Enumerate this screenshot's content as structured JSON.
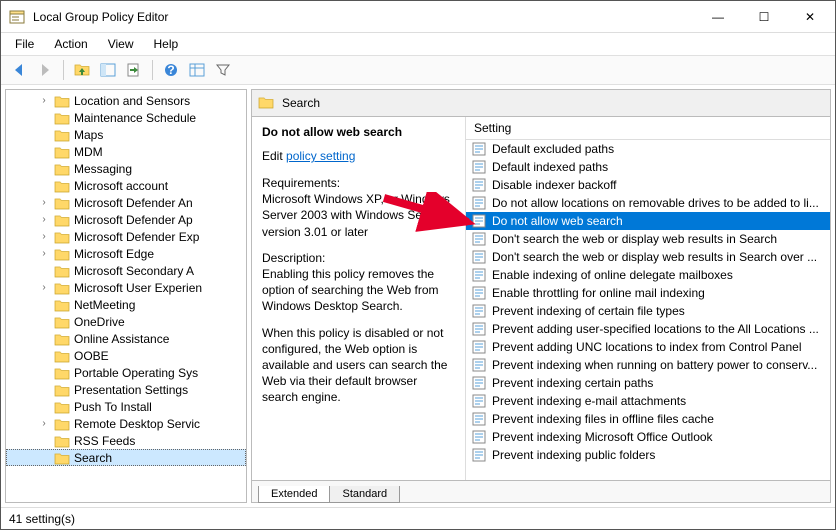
{
  "window_title": "Local Group Policy Editor",
  "window_controls": {
    "min": "—",
    "max": "☐",
    "close": "✕"
  },
  "menus": [
    "File",
    "Action",
    "View",
    "Help"
  ],
  "toolbar_icons": [
    "back-icon",
    "forward-icon",
    "up-folder-icon",
    "props-icon",
    "export-icon",
    "help-icon",
    "grid-icon",
    "filter-icon"
  ],
  "crumb_label": "Search",
  "tree": [
    {
      "label": "Location and Sensors",
      "exp": ">"
    },
    {
      "label": "Maintenance Schedule",
      "exp": ""
    },
    {
      "label": "Maps",
      "exp": ""
    },
    {
      "label": "MDM",
      "exp": ""
    },
    {
      "label": "Messaging",
      "exp": ""
    },
    {
      "label": "Microsoft account",
      "exp": ""
    },
    {
      "label": "Microsoft Defender An",
      "exp": ">"
    },
    {
      "label": "Microsoft Defender Ap",
      "exp": ">"
    },
    {
      "label": "Microsoft Defender Exp",
      "exp": ">"
    },
    {
      "label": "Microsoft Edge",
      "exp": ">"
    },
    {
      "label": "Microsoft Secondary A",
      "exp": ""
    },
    {
      "label": "Microsoft User Experien",
      "exp": ">"
    },
    {
      "label": "NetMeeting",
      "exp": ""
    },
    {
      "label": "OneDrive",
      "exp": ""
    },
    {
      "label": "Online Assistance",
      "exp": ""
    },
    {
      "label": "OOBE",
      "exp": ""
    },
    {
      "label": "Portable Operating Sys",
      "exp": ""
    },
    {
      "label": "Presentation Settings",
      "exp": ""
    },
    {
      "label": "Push To Install",
      "exp": ""
    },
    {
      "label": "Remote Desktop Servic",
      "exp": ">"
    },
    {
      "label": "RSS Feeds",
      "exp": ""
    },
    {
      "label": "Search",
      "exp": "",
      "selected": true
    }
  ],
  "desc": {
    "title": "Do not allow web search",
    "edit_prefix": "Edit ",
    "edit_link": "policy setting ",
    "req_label": "Requirements:",
    "req_text": "Microsoft Windows XP, or Windows Server 2003 with Windows Search version 3.01 or later",
    "desc_label": "Description:",
    "desc_text1": "Enabling this policy removes the option of searching the Web from Windows Desktop Search.",
    "desc_text2": "When this policy is disabled or not configured, the Web option is available and users can search the Web via their default browser search engine."
  },
  "list_header": "Setting",
  "settings": [
    "Default excluded paths",
    "Default indexed paths",
    "Disable indexer backoff",
    "Do not allow locations on removable drives to be added to li...",
    "Do not allow web search",
    "Don't search the web or display web results in Search",
    "Don't search the web or display web results in Search over ...",
    "Enable indexing of online delegate mailboxes",
    "Enable throttling for online mail indexing",
    "Prevent indexing of certain file types",
    "Prevent adding user-specified locations to the All Locations ...",
    "Prevent adding UNC locations to index from Control Panel",
    "Prevent indexing when running on battery power to conserv...",
    "Prevent indexing certain paths",
    "Prevent indexing e-mail attachments",
    "Prevent indexing files in offline files cache",
    "Prevent indexing Microsoft Office Outlook",
    "Prevent indexing public folders"
  ],
  "selected_setting_index": 4,
  "tabs": {
    "extended": "Extended",
    "standard": "Standard"
  },
  "status_text": "41 setting(s)"
}
